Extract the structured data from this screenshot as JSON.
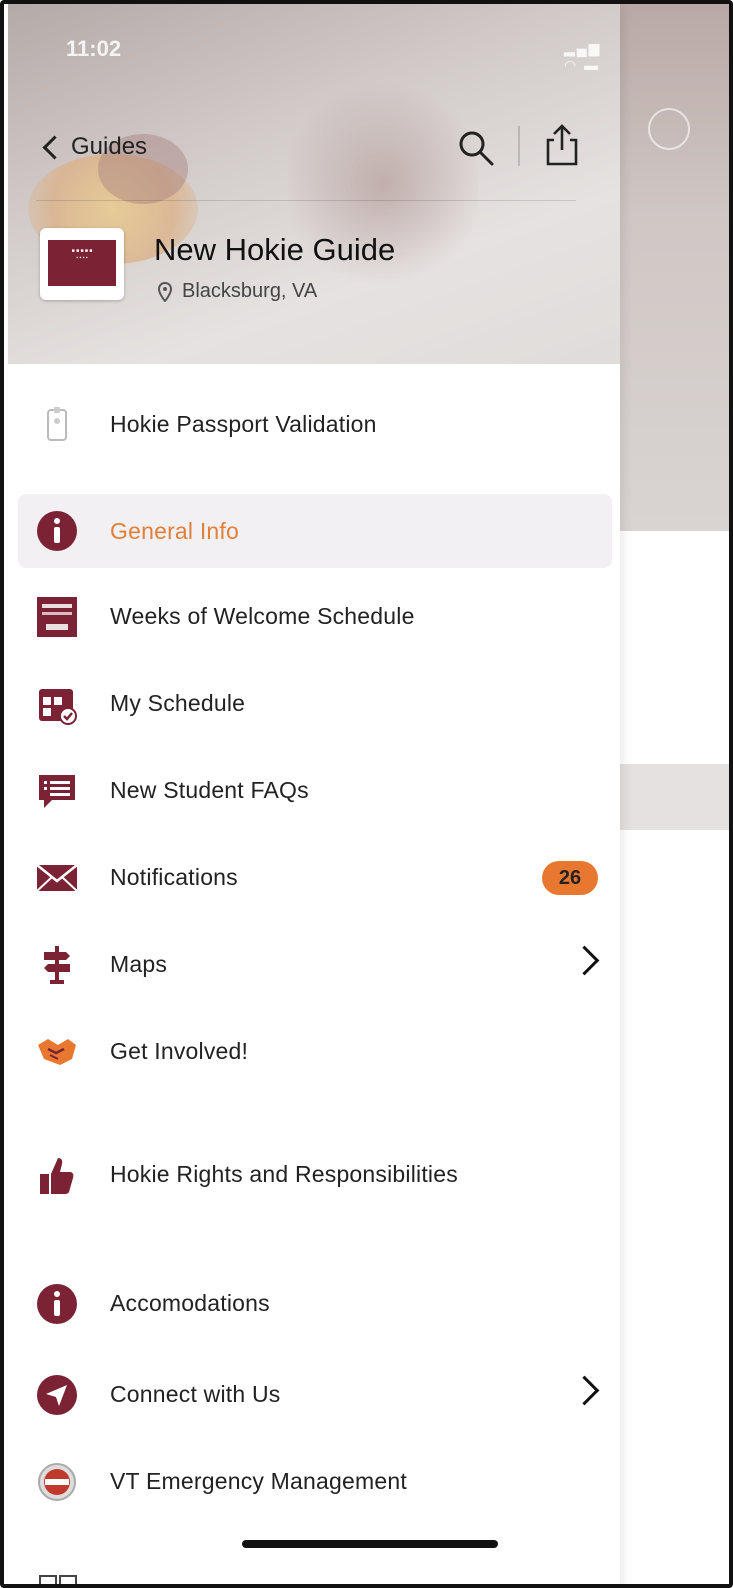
{
  "status_bar": {
    "time": "11:02"
  },
  "header": {
    "back_label": "Guides",
    "title": "New Hokie Guide",
    "location": "Blacksburg, VA"
  },
  "menu": [
    {
      "label": "Hokie Passport Validation",
      "icon": "id-badge-icon"
    },
    {
      "label": "General Info",
      "icon": "info-icon",
      "active": true
    },
    {
      "label": "Weeks of Welcome Schedule",
      "icon": "schedule-poster-icon"
    },
    {
      "label": "My Schedule",
      "icon": "calendar-check-icon"
    },
    {
      "label": "New Student FAQs",
      "icon": "chat-list-icon"
    },
    {
      "label": "Notifications",
      "icon": "envelope-icon",
      "badge": "26"
    },
    {
      "label": "Maps",
      "icon": "signpost-icon",
      "has_arrow": true
    },
    {
      "label": "Get Involved!",
      "icon": "handshake-icon"
    },
    {
      "label": "Hokie Rights and Responsibilities",
      "icon": "thumbs-up-icon"
    },
    {
      "label": "Accomodations",
      "icon": "info-icon"
    },
    {
      "label": "Connect with Us",
      "icon": "navigation-arrow-icon",
      "has_arrow": true
    },
    {
      "label": "VT Emergency Management",
      "icon": "emergency-badge-icon"
    }
  ],
  "colors": {
    "maroon": "#7b2335",
    "orange": "#e8772f",
    "active_text": "#e0803b"
  }
}
